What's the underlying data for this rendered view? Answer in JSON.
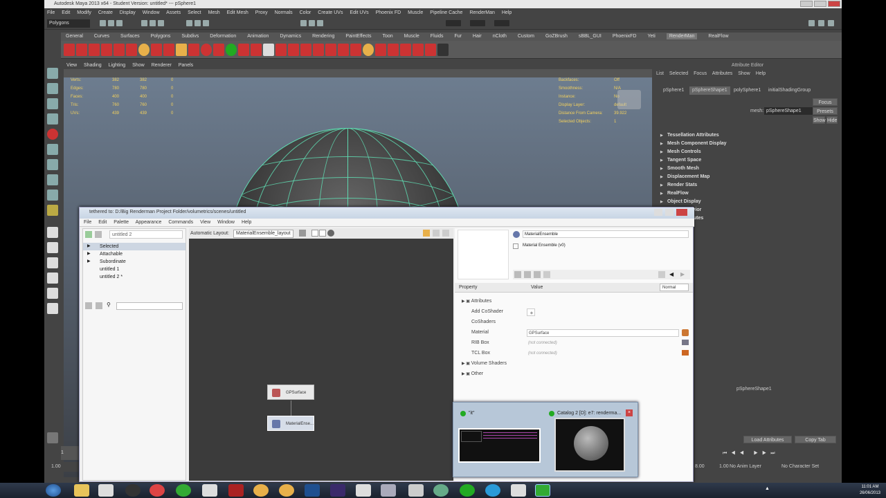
{
  "maya": {
    "title": "Autodesk Maya 2013 x64 - Student Version: untitled*   ---   pSphere1",
    "menus": [
      "File",
      "Edit",
      "Modify",
      "Create",
      "Display",
      "Window",
      "Assets",
      "Select",
      "Mesh",
      "Edit Mesh",
      "Proxy",
      "Normals",
      "Color",
      "Create UVs",
      "Edit UVs",
      "Phoenix FD",
      "Muscle",
      "Pipeline Cache",
      "RenderMan",
      "Help"
    ],
    "mode_menu": "Polygons",
    "shelf_tabs": [
      "General",
      "Curves",
      "Surfaces",
      "Polygons",
      "Subdivs",
      "Deformation",
      "Animation",
      "Dynamics",
      "Rendering",
      "PaintEffects",
      "Toon",
      "Muscle",
      "Fluids",
      "Fur",
      "Hair",
      "nCloth",
      "Custom",
      "GoZBrush",
      "sBBL_GUI",
      "PhoenixFD",
      "Yeti",
      "RenderMan",
      "RealFlow"
    ],
    "active_shelf": "RenderMan",
    "viewport_menu": [
      "View",
      "Shading",
      "Lighting",
      "Show",
      "Renderer",
      "Panels"
    ],
    "hud_left": [
      {
        "label": "Verts:",
        "a": "382",
        "b": "382",
        "c": "0"
      },
      {
        "label": "Edges:",
        "a": "780",
        "b": "780",
        "c": "0"
      },
      {
        "label": "Faces:",
        "a": "400",
        "b": "400",
        "c": "0"
      },
      {
        "label": "Tris:",
        "a": "760",
        "b": "760",
        "c": "0"
      },
      {
        "label": "UVs:",
        "a": "439",
        "b": "439",
        "c": "0"
      }
    ],
    "hud_right": [
      {
        "label": "Backfaces:",
        "value": "Off"
      },
      {
        "label": "Smoothness:",
        "value": "N/A"
      },
      {
        "label": "Instance:",
        "value": "No"
      },
      {
        "label": "Display Layer:",
        "value": "default"
      },
      {
        "label": "Distance From Camera:",
        "value": "39.922"
      },
      {
        "label": "Selected Objects:",
        "value": "1"
      }
    ],
    "frame_start": "1",
    "frame_start2": "1.00",
    "range_end": "1.00",
    "range_end2": "8.00",
    "anim_layer": "No Anim Layer",
    "character_set": "No Character Set"
  },
  "attribute_editor": {
    "title": "Attribute Editor",
    "menu": [
      "List",
      "Selected",
      "Focus",
      "Attributes",
      "Show",
      "Help"
    ],
    "tabs": [
      "pSphere1",
      "pSphereShape1",
      "polySphere1",
      "initialShadingGroup"
    ],
    "active_tab": "pSphereShape1",
    "mesh_label": "mesh:",
    "mesh_value": "pSphereShape1",
    "buttons": [
      "Focus",
      "Presets",
      "Show",
      "Hide"
    ],
    "sections": [
      "Tessellation Attributes",
      "Mesh Component Display",
      "Mesh Controls",
      "Tangent Space",
      "Smooth Mesh",
      "Displacement Map",
      "Render Stats",
      "RealFlow",
      "Object Display",
      "Node Behavior",
      "Extra Attributes"
    ],
    "bottom_label": "pSphereShape1",
    "load_attributes": "Load Attributes",
    "copy_tab": "Copy Tab"
  },
  "slim": {
    "title": "tethered to: D:/Big Renderman Project Folder/volumetrics/scenes/untitled",
    "menus": [
      "File",
      "Edit",
      "Palette",
      "Appearance",
      "Commands",
      "View",
      "Window",
      "Help"
    ],
    "palette_dropdown": "untitled 2",
    "tree": [
      {
        "label": "Selected",
        "level": 0
      },
      {
        "label": "Attachable",
        "level": 0
      },
      {
        "label": "Subordinate",
        "level": 0
      },
      {
        "label": "untitled 1",
        "level": 1
      },
      {
        "label": "untitled 2 *",
        "level": 1
      }
    ],
    "graph_label": "Automatic Layout:",
    "graph_dropdown": "MaterialEnsemble_layout",
    "nodes": [
      {
        "label": "GPSurface"
      },
      {
        "label": "MaterialEnse..."
      }
    ],
    "selected_name": "MaterialEnsemble",
    "selected_type": "Material Ensemble (v0)",
    "property_header": "Property",
    "value_header": "Value",
    "mode": "Normal",
    "properties": [
      {
        "name": "Attributes",
        "value": "",
        "group": true
      },
      {
        "name": "Add CoShader",
        "value": "+",
        "group": false
      },
      {
        "name": "CoShaders",
        "value": "",
        "group": false
      },
      {
        "name": "Material",
        "value": "GPSurface",
        "group": false
      },
      {
        "name": "RIB Box",
        "value": "(not connected)",
        "group": false
      },
      {
        "name": "TCL Box",
        "value": "(not connected)",
        "group": false
      },
      {
        "name": "Volume Shaders",
        "value": "",
        "group": true
      },
      {
        "name": "Other",
        "value": "",
        "group": true
      }
    ]
  },
  "popup": {
    "left_title": "\"it\"",
    "right_title": "Catalog 2 [D]: e7: renderma..."
  },
  "taskbar": {
    "time": "11:01 AM",
    "date": "26/06/2013"
  },
  "colors": {
    "wireframe": "#5fd9b0",
    "hud": "#f5d25c",
    "maya_bg": "#444444"
  }
}
